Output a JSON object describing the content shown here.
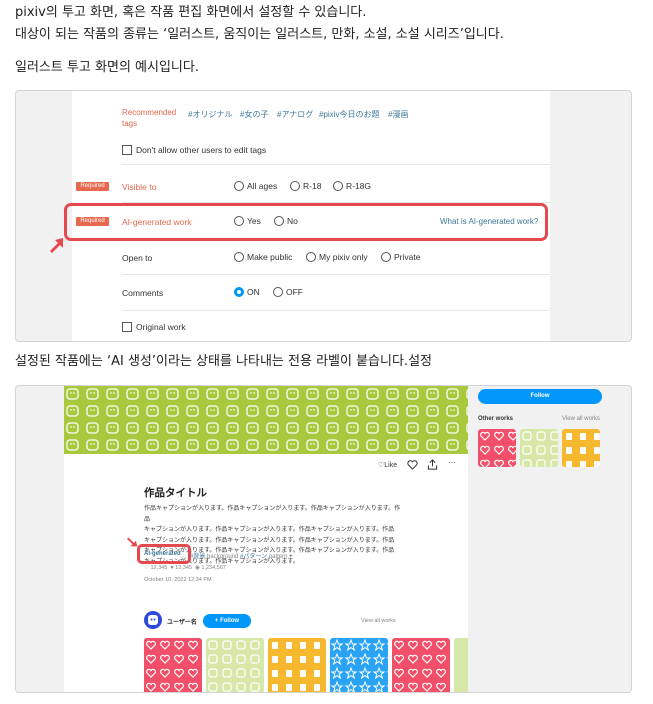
{
  "intro": {
    "line1": "pixiv의 투고 화면, 혹은 작품 편집 화면에서 설정할 수 있습니다.",
    "line2": "대상이 되는 작품의 종류는 ‘일러스트, 움직이는 일러스트, 만화, 소설, 소설 시리즈’입니다.",
    "example_caption": "일러스트 투고 화면의 예시입니다."
  },
  "upload_form": {
    "recommended_label_1": "Recommended",
    "recommended_label_2": "tags",
    "tags": [
      "#オリジナル",
      "#女の子",
      "#アナログ",
      "#pixiv今日のお題",
      "#漫画"
    ],
    "no_edit_checkbox": "Don't allow other users to edit tags",
    "required_badge": "Required",
    "visible_to": {
      "label": "Visible to",
      "options": [
        "All ages",
        "R-18",
        "R-18G"
      ]
    },
    "ai_generated": {
      "label": "AI-generated work",
      "options": [
        "Yes",
        "No"
      ],
      "help_link": "What is AI-generated work?"
    },
    "open_to": {
      "label": "Open to",
      "options": [
        "Make public",
        "My pixiv only",
        "Private"
      ]
    },
    "comments": {
      "label": "Comments",
      "options": [
        "ON",
        "OFF"
      ],
      "selected": "ON"
    },
    "original_checkbox": "Original work"
  },
  "label_caption": "설정된 작품에는 ‘AI 생성’이라는 상태를 나타내는 전용 라벨이 붙습니다.설정",
  "artwork_page": {
    "toolbar": {
      "like": "Like",
      "heart_icon": "heart-icon",
      "share_icon": "share-icon",
      "more": "···"
    },
    "title": "作品タイトル",
    "caption_lines": [
      "作品キャプションが入ります。作品キャプションが入ります。作品キャプションが入ります。作品",
      "キャプションが入ります。作品キャプションが入ります。作品キャプションが入ります。作品",
      "キャプションが入ります。作品キャプションが入ります。作品キャプションが入ります。作品",
      "キャプションが入ります。作品キャプションが入ります。作品キャプションが入ります。作品",
      "キャプションが入ります。作品キャプションが入ります。"
    ],
    "ai_badge": "AI-generated",
    "tag1": "#背景",
    "tag1_translation": "background",
    "tag2": "#パターン",
    "tag2_translation": "pattern",
    "add_tag": "+",
    "likes": "12,345",
    "bookmarks": "12,345",
    "views": "1,234,567",
    "date": "October 10, 2022 12:34 PM",
    "user_name": "ユーザー名",
    "follow": "+ Follow",
    "view_all": "View all works",
    "sidebar": {
      "follow": "Follow",
      "other_works": "Other works",
      "view_all": "View all works"
    }
  },
  "colors": {
    "accent_red": "#e5484d",
    "required_badge": "#e5684f",
    "pixiv_blue": "#0096fa",
    "pattern_green": "#a8c93e",
    "thumb_pink": "#f2506a",
    "thumb_light": "#d7e7a8",
    "thumb_orange": "#f5b82e",
    "thumb_blue": "#2aa3f5"
  }
}
